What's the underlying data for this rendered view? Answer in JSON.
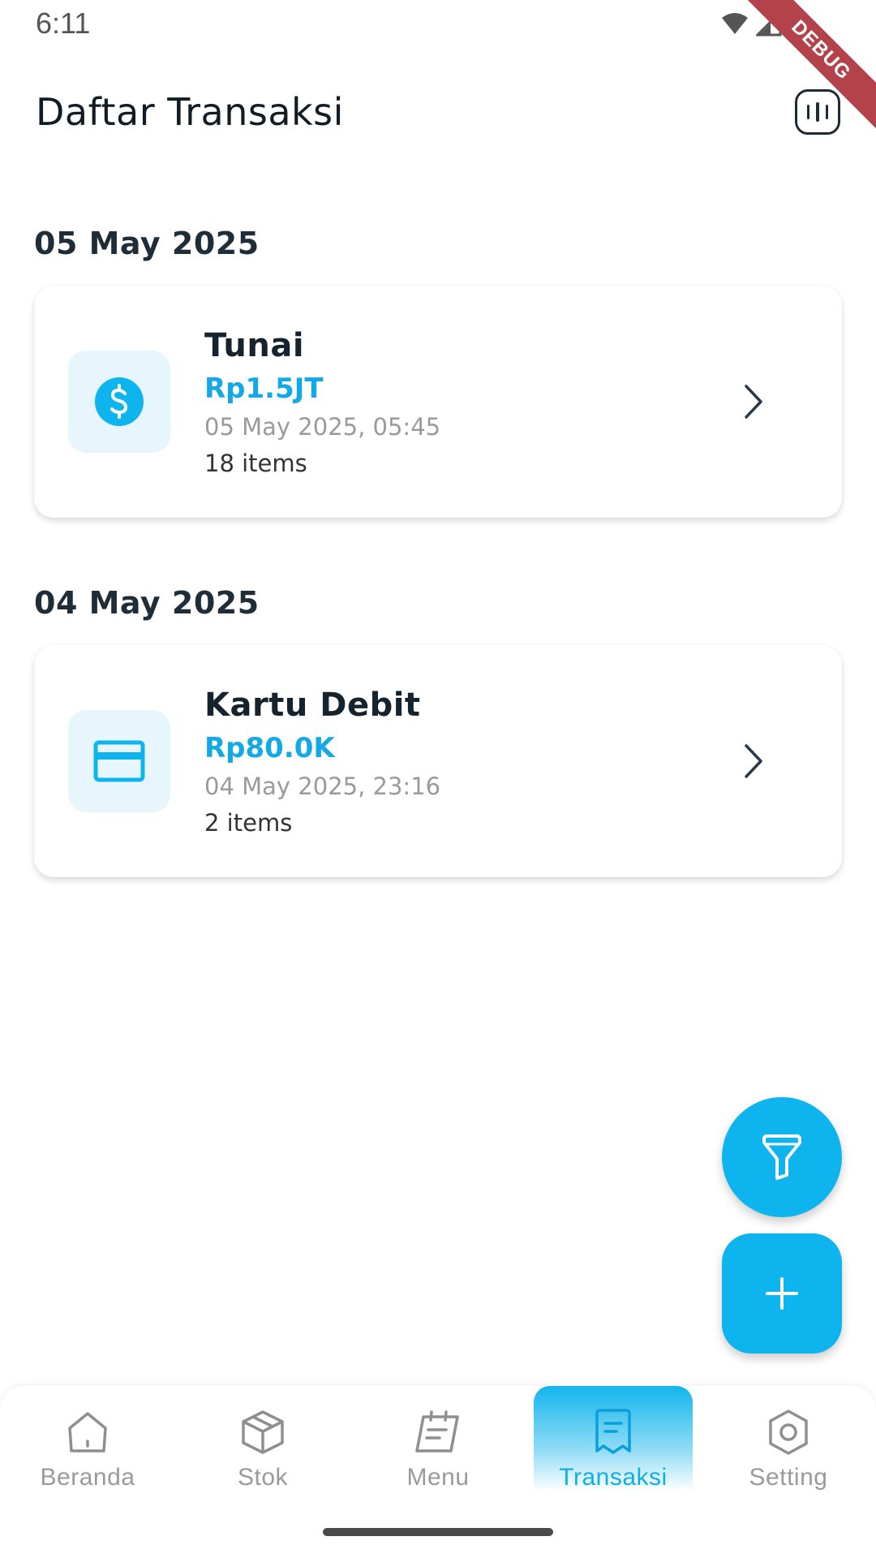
{
  "status_bar": {
    "time": "6:11"
  },
  "debug_banner": "DEBUG",
  "header": {
    "title": "Daftar Transaksi",
    "action_icon": "report-chart-icon"
  },
  "transactions": [
    {
      "date": "05 May 2025",
      "method": "Tunai",
      "amount": "Rp1.5JT",
      "datetime": "05 May 2025, 05:45",
      "items": "18 items",
      "icon": "dollar-circle-icon"
    },
    {
      "date": "04 May 2025",
      "method": "Kartu Debit",
      "amount": "Rp80.0K",
      "datetime": "04 May 2025, 23:16",
      "items": "2 items",
      "icon": "credit-card-icon"
    }
  ],
  "fabs": {
    "filter_icon": "filter-icon",
    "add_icon": "plus-icon"
  },
  "bottom_nav": {
    "items": [
      {
        "label": "Beranda",
        "icon": "home-icon"
      },
      {
        "label": "Stok",
        "icon": "box-icon"
      },
      {
        "label": "Menu",
        "icon": "menu-notes-icon"
      },
      {
        "label": "Transaksi",
        "icon": "receipt-icon"
      },
      {
        "label": "Setting",
        "icon": "settings-icon"
      }
    ],
    "active": "Transaksi"
  },
  "colors": {
    "accent": "#0DB4EE",
    "accent_light": "#E7F6FD",
    "debug": "#B3424A"
  }
}
